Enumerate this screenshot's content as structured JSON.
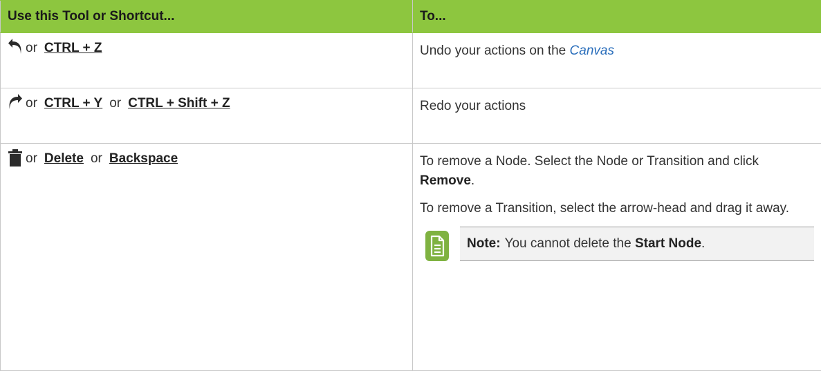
{
  "header": {
    "col1": "Use this Tool or Shortcut...",
    "col2": "To..."
  },
  "rows": [
    {
      "icon": "undo-arrow-icon",
      "shortcut_or_1": "or",
      "shortcut_1": "CTRL + Z",
      "action_prefix": "Undo your actions on the ",
      "action_link": "Canvas"
    },
    {
      "icon": "redo-arrow-icon",
      "shortcut_or_1": "or",
      "shortcut_1": "CTRL + Y",
      "shortcut_or_2": "or",
      "shortcut_2": "CTRL + Shift + Z",
      "action": "Redo your actions"
    },
    {
      "icon": "trash-icon",
      "shortcut_or_1": "or",
      "shortcut_1": "Delete",
      "shortcut_or_2": "or",
      "shortcut_2": "Backspace",
      "para1_a": "To remove a Node. Select the Node or Transition and click ",
      "para1_bold": "Remove",
      "para1_end": ".",
      "para2": "To remove a Transition, select the arrow-head and drag it away.",
      "note": {
        "icon": "note-document-icon",
        "label": "Note:",
        "text_a": "You cannot delete the ",
        "text_bold": "Start Node",
        "text_end": "."
      }
    }
  ],
  "colors": {
    "header_bg": "#8dc63f",
    "link": "#2a6ebb",
    "note_bg": "#f2f2f2",
    "note_icon": "#7fb241"
  }
}
